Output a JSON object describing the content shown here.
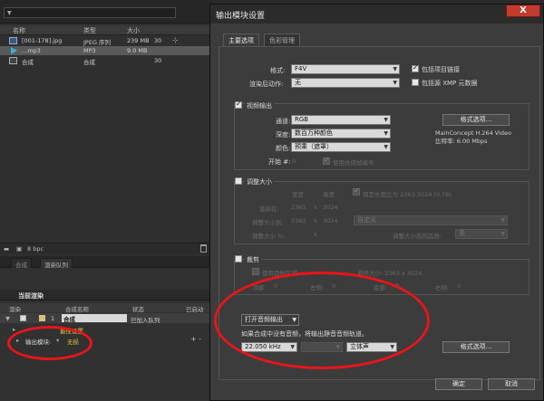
{
  "project": {
    "headers": {
      "name": "名称",
      "type": "类型",
      "size": "大小"
    },
    "items": [
      {
        "name": "[001-178].jpg",
        "type": "JPEG 序列",
        "size": "239 MB",
        "extra": "30"
      },
      {
        "name": "...mp3",
        "type": "MP3",
        "size": "9.0 MB",
        "extra": ""
      },
      {
        "name": "合成",
        "type": "合成",
        "size": "",
        "extra": "30"
      }
    ],
    "bpc": "8 bpc"
  },
  "render_queue": {
    "tabs": [
      "合成",
      "渲染队列"
    ],
    "current_render": "当前渲染",
    "headers": {
      "render": "渲染",
      "comp_name": "合成名称",
      "status": "状态",
      "started": "已启动"
    },
    "row": {
      "num": "1",
      "comp": "合成",
      "status": "已加入队列"
    },
    "render_settings_value": "最佳设置",
    "output_module_label": "输出模块:",
    "output_module_value": "无损",
    "plus_minus": "+ -"
  },
  "dialog": {
    "title": "输出模块设置",
    "close": "X",
    "tabs": [
      "主要选项",
      "色彩管理"
    ],
    "format_label": "格式:",
    "format_value": "F4V",
    "include_project_link": "包括项目链接",
    "post_render_label": "渲染后动作:",
    "post_render_value": "无",
    "include_xmp": "包括源 XMP 元数据",
    "video_output": "视频输出",
    "channels_label": "通道:",
    "channels_value": "RGB",
    "format_options_btn": "格式选项...",
    "depth_label": "深度:",
    "depth_value": "数百万种颜色",
    "color_label": "颜色:",
    "color_value": "预乘（遮罩）",
    "codec_info_1": "MainConcept H.264 Video",
    "codec_info_2": "比特率: 6.00 Mbps",
    "start_label": "开始 #:",
    "start_value": "0",
    "use_comp_frame": "使用合成帧编号",
    "resize": {
      "title": "调整大小",
      "width": "宽度",
      "height": "高度",
      "lock_ratio": "锁定长宽比为 2363:3024 (0.78)",
      "rendering_at": "渲染在:",
      "rw": "2363",
      "x1": "x",
      "rh": "3024",
      "resize_to": "调整大小到:",
      "tw": "2363",
      "x2": "x",
      "th": "3024",
      "custom": "自定义",
      "resize_pct": "调整大小 %:",
      "x3": "x",
      "quality": "调整大小后的品质:",
      "quality_value": "高"
    },
    "crop": {
      "title": "裁剪",
      "use_roi": "使用目标区域",
      "final_size": "最终大小: 2363 x 3024",
      "top": "顶部:",
      "top_v": "0",
      "left": "左侧:",
      "left_v": "0",
      "bottom": "底部:",
      "bottom_v": "0",
      "right": "右侧:",
      "right_v": "0"
    },
    "audio": {
      "open_audio": "打开音频输出",
      "note": "如果合成中没有音频，将输出静音音频轨道。",
      "rate": "22.050 kHz",
      "bits": "",
      "channels": "立体声",
      "format_options_btn": "格式选项..."
    },
    "ok": "确定",
    "cancel": "取消"
  },
  "colors": {
    "annotation": "#e8151b",
    "close_button": "#c23b2f"
  }
}
